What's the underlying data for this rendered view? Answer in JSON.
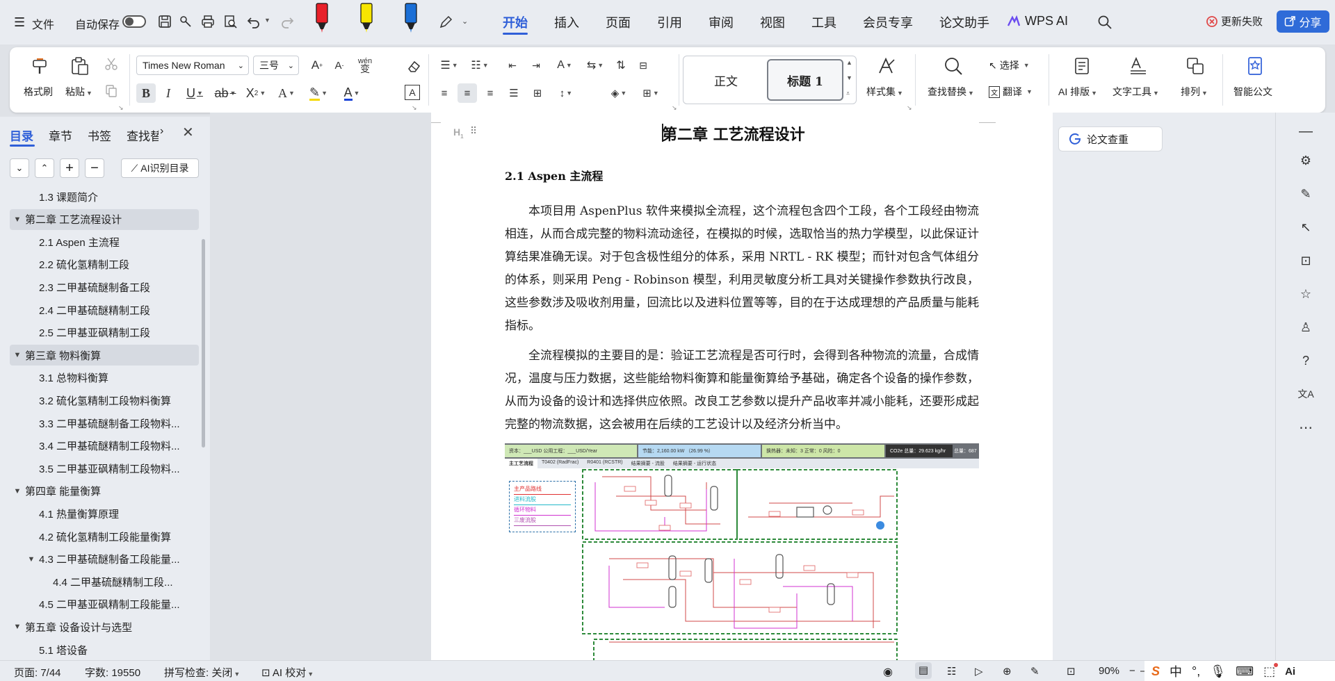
{
  "topbar": {
    "file_label": "文件",
    "autosave_label": "自动保存",
    "menu_tabs": [
      "开始",
      "插入",
      "页面",
      "引用",
      "审阅",
      "视图",
      "工具",
      "会员专享",
      "论文助手"
    ],
    "wps_ai_label": "WPS AI",
    "update_fail_label": "更新失败",
    "share_label": "分享"
  },
  "ribbon": {
    "format_painter": "格式刷",
    "paste": "粘贴",
    "font_name": "Times New Roman",
    "font_size": "三号",
    "style_normal": "正文",
    "style_heading1": "标题 1",
    "style_set": "样式集",
    "find_replace": "查找替换",
    "select": "选择",
    "translate": "翻译",
    "ai_layout": "AI 排版",
    "text_tools": "文字工具",
    "arrange": "排列",
    "smart_doc": "智能公文"
  },
  "leftpanel": {
    "tabs": [
      "目录",
      "章节",
      "书签",
      "查找替"
    ],
    "ai_toc_button": "AI识别目录",
    "toc": [
      {
        "label": "1.3 课题简介",
        "level": 2,
        "arrow": "",
        "selected": false
      },
      {
        "label": "第二章 工艺流程设计",
        "level": 1,
        "arrow": "▼",
        "selected": true
      },
      {
        "label": "2.1 Aspen 主流程",
        "level": 2,
        "arrow": "",
        "selected": false
      },
      {
        "label": "2.2 硫化氢精制工段",
        "level": 2,
        "arrow": "",
        "selected": false
      },
      {
        "label": "2.3 二甲基硫醚制备工段",
        "level": 2,
        "arrow": "",
        "selected": false
      },
      {
        "label": "2.4 二甲基硫醚精制工段",
        "level": 2,
        "arrow": "",
        "selected": false
      },
      {
        "label": "2.5 二甲基亚砜精制工段",
        "level": 2,
        "arrow": "",
        "selected": false
      },
      {
        "label": "第三章 物料衡算",
        "level": 1,
        "arrow": "▼",
        "selected": true
      },
      {
        "label": "3.1 总物料衡算",
        "level": 2,
        "arrow": "",
        "selected": false
      },
      {
        "label": "3.2 硫化氢精制工段物料衡算",
        "level": 2,
        "arrow": "",
        "selected": false
      },
      {
        "label": "3.3 二甲基硫醚制备工段物料...",
        "level": 2,
        "arrow": "",
        "selected": false
      },
      {
        "label": "3.4 二甲基硫醚精制工段物料...",
        "level": 2,
        "arrow": "",
        "selected": false
      },
      {
        "label": "3.5 二甲基亚砜精制工段物料...",
        "level": 2,
        "arrow": "",
        "selected": false
      },
      {
        "label": "第四章 能量衡算",
        "level": 1,
        "arrow": "▼",
        "selected": false
      },
      {
        "label": "4.1 热量衡算原理",
        "level": 2,
        "arrow": "",
        "selected": false
      },
      {
        "label": "4.2 硫化氢精制工段能量衡算",
        "level": 2,
        "arrow": "",
        "selected": false
      },
      {
        "label": "4.3 二甲基硫醚制备工段能量...",
        "level": 2,
        "arrow": "▼",
        "selected": false
      },
      {
        "label": "4.4 二甲基硫醚精制工段...",
        "level": 3,
        "arrow": "",
        "selected": false
      },
      {
        "label": "4.5 二甲基亚砜精制工段能量...",
        "level": 2,
        "arrow": "",
        "selected": false
      },
      {
        "label": "第五章 设备设计与选型",
        "level": 1,
        "arrow": "▼",
        "selected": false
      },
      {
        "label": "5.1 塔设备",
        "level": 2,
        "arrow": "",
        "selected": false
      }
    ]
  },
  "document": {
    "chapter_title": "第二章 工艺流程设计",
    "section_title": "2.1 Aspen 主流程",
    "para1": "本项目用 AspenPlus 软件来模拟全流程，这个流程包含四个工段，各个工段经由物流相连，从而合成完整的物料流动途径，在模拟的时候，选取恰当的热力学模型，以此保证计算结果准确无误。对于包含极性组分的体系，采用 NRTL - RK 模型；而针对包含气体组分的体系，则采用 Peng - Robinson 模型，利用灵敏度分析工具对关键操作参数执行改良，这些参数涉及吸收剂用量，回流比以及进料位置等等，目的在于达成理想的产品质量与能耗指标。",
    "para2": "全流程模拟的主要目的是：验证工艺流程是否可行时，会得到各种物流的流量，合成情况，温度与压力数据，这些能给物料衡算和能量衡算给予基础，确定各个设备的操作参数，从而为设备的设计和选择供应依照。改良工艺参数以提升产品收率并减小能耗，还要形成起完整的物流数据，这会被用在后续的工艺设计以及经济分析当中。"
  },
  "diagram": {
    "status_cost": "资本：___USD  公用工程：___USD/Year",
    "status_energy": "节能：2,160.00 kW （26.99 %）",
    "status_exchanger": "换热器：未知：3  正常：0  风险：0",
    "status_co2": "CO2e 总量：29.623 kg/hr",
    "status_co2_cut": "总量：687",
    "tabs": [
      "主工艺流程",
      "T0402 (RadFrac)",
      "R0401 (RCSTR)",
      "结果摘要 - 流股",
      "结果摘要 - 运行状态"
    ],
    "legend": [
      "主产品路线",
      "进料流股",
      "循环物料",
      "三废流股"
    ]
  },
  "rightpanel": {
    "paper_check": "论文查重"
  },
  "statusbar": {
    "page": "页面: 7/44",
    "words": "字数: 19550",
    "spellcheck": "拼写检查: 关闭",
    "ai_proof": "AI 校对",
    "zoom": "90%"
  },
  "colors": {
    "accent": "#2f5fd8",
    "share_bg": "#2f6bd8",
    "update_fail": "#e04848"
  }
}
